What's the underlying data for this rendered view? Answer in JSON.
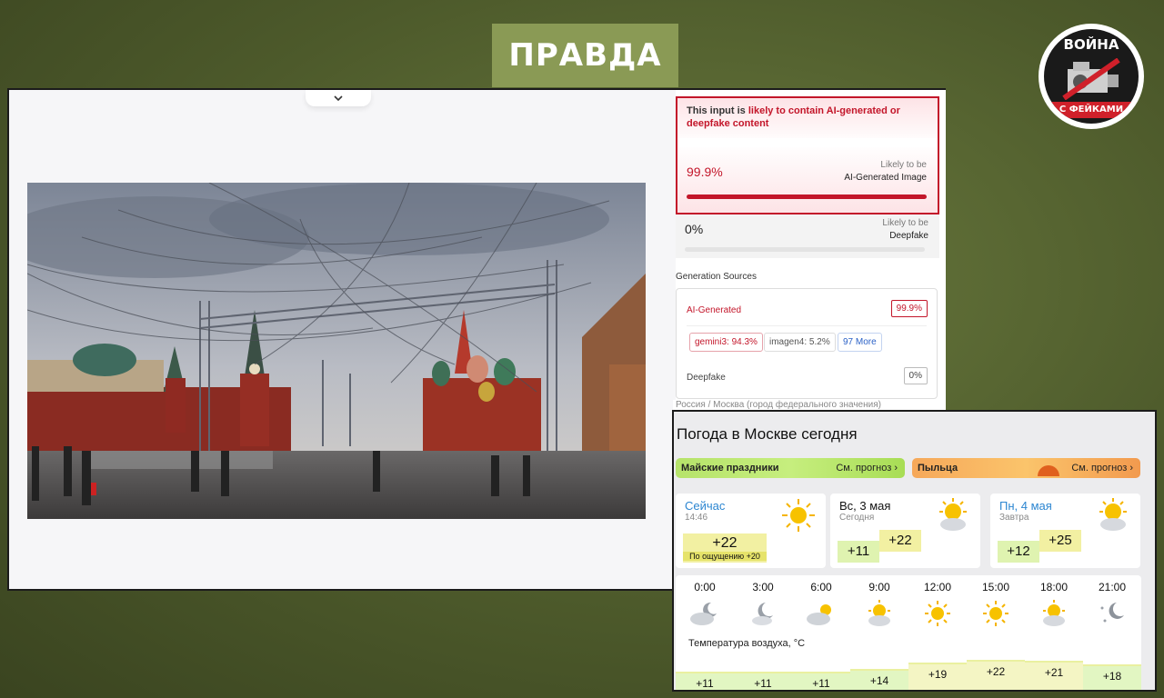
{
  "header": {
    "title": "ПРАВДА"
  },
  "logo": {
    "top_text": "ВОЙНА",
    "band_text": "С ФЕЙКАМИ"
  },
  "detection": {
    "alert_prefix": "This input is ",
    "alert_highlight": "likely to contain AI-generated or deepfake content",
    "ai_percent": "99.9%",
    "ai_label_1": "Likely to be",
    "ai_label_2": "AI-Generated Image",
    "deepfake_percent": "0%",
    "deepfake_label_1": "Likely to be",
    "deepfake_label_2": "Deepfake",
    "sources_title": "Generation Sources",
    "source_ai_label": "AI-Generated",
    "source_ai_percent": "99.9%",
    "chips": [
      "gemini3: 94.3%",
      "imagen4: 5.2%",
      "97 More"
    ],
    "source_deepfake_label": "Deepfake",
    "source_deepfake_percent": "0%"
  },
  "weather": {
    "breadcrumb": "Россия / Москва (город федерального значения)",
    "title": "Погода в Москве сегодня",
    "banner_left": {
      "label": "Майские праздники",
      "link": "См. прогноз ›"
    },
    "banner_right": {
      "label": "Пыльца",
      "link": "См. прогноз ›"
    },
    "now": {
      "day": "Сейчас",
      "time": "14:46",
      "temp": "+22",
      "feels": "По ощущению +20"
    },
    "today": {
      "day": "Вс, 3 мая",
      "sub": "Сегодня",
      "low": "+11",
      "high": "+22"
    },
    "tomorrow": {
      "day": "Пн, 4 мая",
      "sub": "Завтра",
      "low": "+12",
      "high": "+25"
    },
    "hours": [
      "0:00",
      "3:00",
      "6:00",
      "9:00",
      "12:00",
      "15:00",
      "18:00",
      "21:00"
    ],
    "hour_icons": [
      "cloud-moon-icon",
      "moon-cloud-icon",
      "cloud-sun-icon",
      "sun-cloud-icon",
      "sun-icon",
      "sun-icon",
      "sun-cloud-icon",
      "moon-stars-icon"
    ],
    "temp_label": "Температура воздуха, °C",
    "temps": [
      11,
      11,
      11,
      14,
      19,
      22,
      21,
      18
    ],
    "temp_labels": [
      "+11",
      "+11",
      "+11",
      "+14",
      "+19",
      "+22",
      "+21",
      "+18"
    ]
  },
  "colors": {
    "alert_red": "#c3162a",
    "badge_green": "#8a9a55",
    "link_blue": "#2c86d1"
  }
}
